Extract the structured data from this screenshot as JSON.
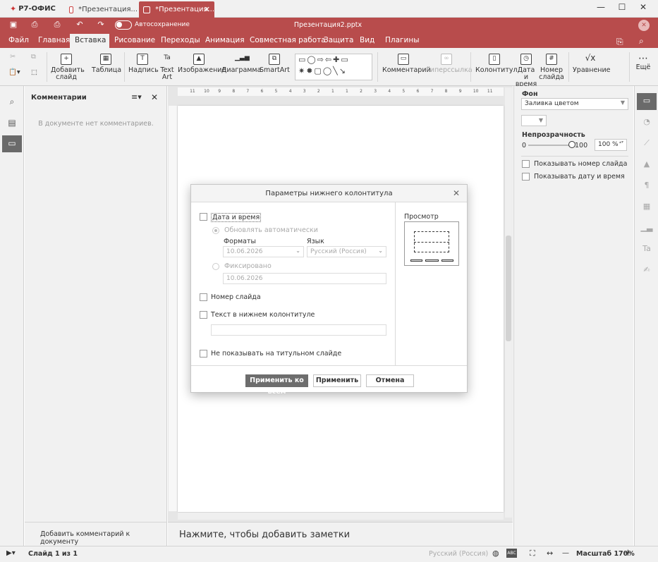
{
  "app": {
    "brand": "Р7-ОФИС",
    "tabs": [
      "*Презентация...",
      "*Презентация..."
    ],
    "doc_title": "Презентация2.pptx",
    "autosave": "Автосохранение"
  },
  "menu": [
    "Файл",
    "Главная",
    "Вставка",
    "Рисование",
    "Переходы",
    "Анимация",
    "Совместная работа",
    "Защита",
    "Вид",
    "Плагины"
  ],
  "toolbar": {
    "add_slide": [
      "Добавить",
      "слайд"
    ],
    "table": "Таблица",
    "caption": "Надпись",
    "text_art": [
      "Text",
      "Art"
    ],
    "image": "Изображение",
    "chart": "Диаграмма",
    "smartart": "SmartArt",
    "comment": "Комментарий",
    "hyperlink": "Гиперссылка",
    "header_footer": "Колонтитул",
    "date_time": [
      "Дата и",
      "время"
    ],
    "slide_number": [
      "Номер",
      "слайда"
    ],
    "equation": "Уравнение",
    "more": "Ещё"
  },
  "comments": {
    "title": "Комментарии",
    "empty": "В документе нет комментариев.",
    "add": "Добавить комментарий к документу"
  },
  "notes_placeholder": "Нажмите, чтобы добавить заметки",
  "ruler": {
    "h_labels": [
      "11",
      "10",
      "9",
      "8",
      "7",
      "6",
      "5",
      "4",
      "3",
      "2",
      "1",
      "1",
      "2",
      "3",
      "4",
      "5",
      "6",
      "7",
      "8",
      "9",
      "10",
      "11"
    ]
  },
  "right_panel": {
    "background_label": "Фон",
    "fill_type": "Заливка цветом",
    "fill_color": "#ffffff",
    "opacity_label": "Непрозрачность",
    "opacity_min": "0",
    "opacity_max": "100",
    "opacity_value": "100 %",
    "opacity_level": 1.0,
    "show_slide_number": "Показывать номер слайда",
    "show_date_time": "Показывать дату и время"
  },
  "dialog": {
    "title": "Параметры нижнего колонтитула",
    "date_time": "Дата и время",
    "update_auto": "Обновлять автоматически",
    "formats_label": "Форматы",
    "formats_value": "10.06.2026",
    "language_label": "Язык",
    "language_value": "Русский (Россия)",
    "fixed": "Фиксировано",
    "fixed_value": "10.06.2026",
    "slide_number": "Номер слайда",
    "footer_text": "Текст в нижнем колонтитуле",
    "dont_show_title": "Не показывать на титульном слайде",
    "preview_label": "Просмотр",
    "apply_all": "Применить ко всем",
    "apply": "Применить",
    "cancel": "Отмена"
  },
  "status": {
    "slide": "Слайд 1 из 1",
    "language": "Русский (Россия)",
    "zoom": "Масштаб 170%"
  },
  "colors": {
    "accent": "#b84c4c",
    "panel": "#f1f1f1",
    "primary_button": "#6d6d6d"
  }
}
